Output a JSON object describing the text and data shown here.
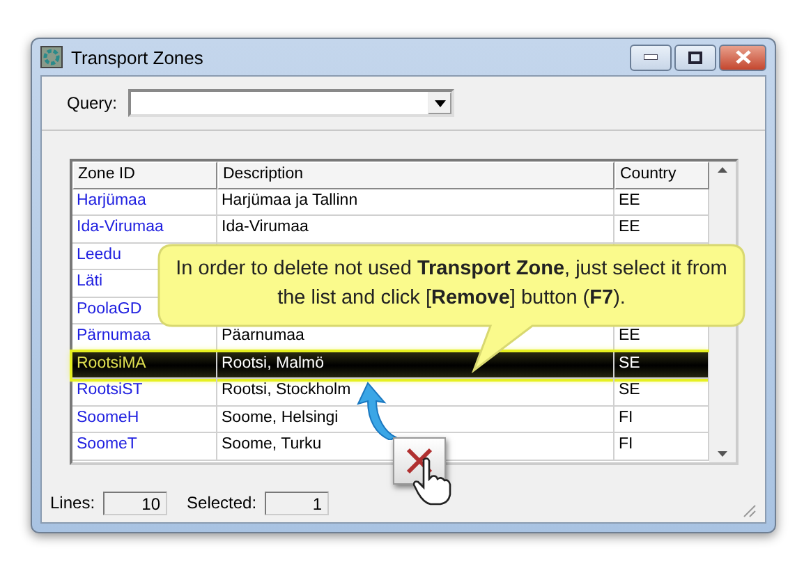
{
  "window": {
    "title": "Transport Zones"
  },
  "query": {
    "label": "Query:"
  },
  "table": {
    "columns": [
      "Zone ID",
      "Description",
      "Country"
    ],
    "rows": [
      {
        "zone_id": "Harjümaa",
        "description": "Harjümaa ja Tallinn",
        "country": "EE",
        "selected": false
      },
      {
        "zone_id": "Ida-Virumaa",
        "description": "Ida-Virumaa",
        "country": "EE",
        "selected": false
      },
      {
        "zone_id": "Leedu",
        "selected": false
      },
      {
        "zone_id": "Läti",
        "selected": false
      },
      {
        "zone_id": "PoolaGD",
        "selected": false
      },
      {
        "zone_id": "Pärnumaa",
        "description": "Päarnumaa",
        "country": "EE",
        "selected": false
      },
      {
        "zone_id": "RootsiMA",
        "description": "Rootsi, Malmö",
        "country": "SE",
        "selected": true
      },
      {
        "zone_id": "RootsiST",
        "description": "Rootsi, Stockholm",
        "country": "SE",
        "selected": false
      },
      {
        "zone_id": "SoomeH",
        "description": "Soome, Helsingi",
        "country": "FI",
        "selected": false
      },
      {
        "zone_id": "SoomeT",
        "description": "Soome, Turku",
        "country": "FI",
        "selected": false
      }
    ]
  },
  "callout": {
    "text": "In order to delete not used **Transport Zone**, just select it from the list and click [**Remove**] button (**F7**)."
  },
  "status_bar": {
    "lines_label": "Lines:",
    "lines": "10",
    "selected_label": "Selected:",
    "selected": "1"
  }
}
